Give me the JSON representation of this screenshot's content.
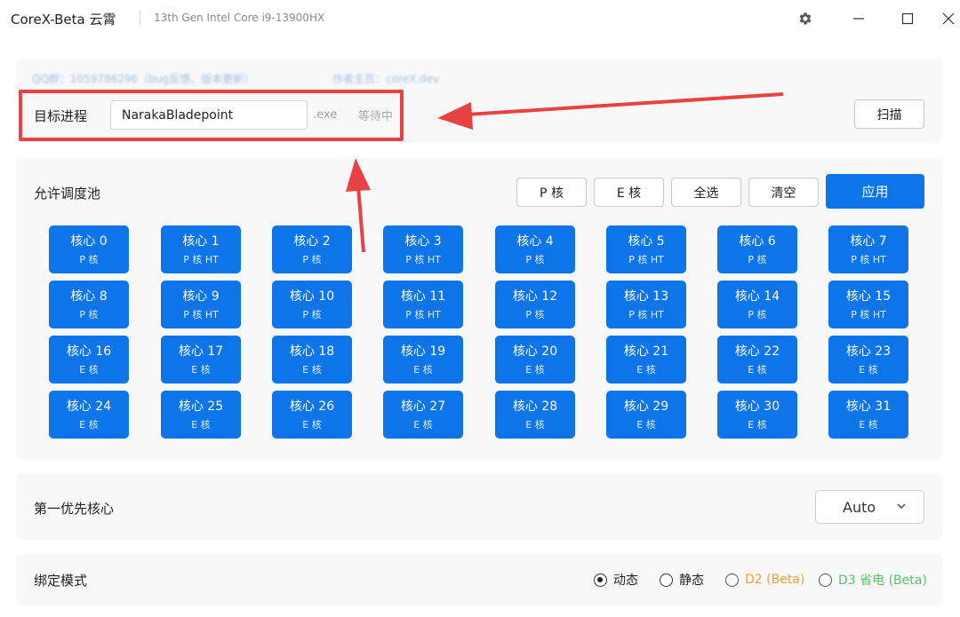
{
  "window": {
    "app_title": "CoreX-Beta  云霄",
    "cpu_name": "13th Gen Intel Core i9-13900HX"
  },
  "target": {
    "qq_line": "QQ群：1059786296（bug反馈、版本更新）",
    "qq_line2": "作者主页：coreX.dev",
    "label": "目标进程",
    "process_value": "NarakaBladepoint",
    "exe_suffix": ".exe",
    "status": "等待中",
    "scan_label": "扫描"
  },
  "pool": {
    "label": "允许调度池",
    "buttons": {
      "p_core": "P 核",
      "e_core": "E 核",
      "select_all": "全选",
      "clear": "清空",
      "apply": "应用"
    },
    "cores": [
      {
        "name": "核心 0",
        "type": "P 核"
      },
      {
        "name": "核心 1",
        "type": "P 核 HT"
      },
      {
        "name": "核心 2",
        "type": "P 核"
      },
      {
        "name": "核心 3",
        "type": "P 核 HT"
      },
      {
        "name": "核心 4",
        "type": "P 核"
      },
      {
        "name": "核心 5",
        "type": "P 核 HT"
      },
      {
        "name": "核心 6",
        "type": "P 核"
      },
      {
        "name": "核心 7",
        "type": "P 核 HT"
      },
      {
        "name": "核心 8",
        "type": "P 核"
      },
      {
        "name": "核心 9",
        "type": "P 核 HT"
      },
      {
        "name": "核心 10",
        "type": "P 核"
      },
      {
        "name": "核心 11",
        "type": "P 核 HT"
      },
      {
        "name": "核心 12",
        "type": "P 核"
      },
      {
        "name": "核心 13",
        "type": "P 核 HT"
      },
      {
        "name": "核心 14",
        "type": "P 核"
      },
      {
        "name": "核心 15",
        "type": "P 核 HT"
      },
      {
        "name": "核心 16",
        "type": "E 核"
      },
      {
        "name": "核心 17",
        "type": "E 核"
      },
      {
        "name": "核心 18",
        "type": "E 核"
      },
      {
        "name": "核心 19",
        "type": "E 核"
      },
      {
        "name": "核心 20",
        "type": "E 核"
      },
      {
        "name": "核心 21",
        "type": "E 核"
      },
      {
        "name": "核心 22",
        "type": "E 核"
      },
      {
        "name": "核心 23",
        "type": "E 核"
      },
      {
        "name": "核心 24",
        "type": "E 核"
      },
      {
        "name": "核心 25",
        "type": "E 核"
      },
      {
        "name": "核心 26",
        "type": "E 核"
      },
      {
        "name": "核心 27",
        "type": "E 核"
      },
      {
        "name": "核心 28",
        "type": "E 核"
      },
      {
        "name": "核心 29",
        "type": "E 核"
      },
      {
        "name": "核心 30",
        "type": "E 核"
      },
      {
        "name": "核心 31",
        "type": "E 核"
      }
    ]
  },
  "priority": {
    "label": "第一优先核心",
    "selected": "Auto"
  },
  "binding": {
    "label": "绑定模式",
    "options": [
      {
        "label": "动态",
        "selected": true
      },
      {
        "label": "静态",
        "selected": false
      },
      {
        "label": "D2 (Beta)",
        "selected": false
      },
      {
        "label": "D3 省电 (Beta)",
        "selected": false
      }
    ]
  },
  "colors": {
    "accent": "#0d74ea",
    "annotation": "#e84242",
    "beta_orange": "#f0a030",
    "beta_green": "#58c36a"
  },
  "icons": [
    "gear-icon",
    "minimize-icon",
    "maximize-icon",
    "close-icon",
    "chevron-down-icon"
  ]
}
